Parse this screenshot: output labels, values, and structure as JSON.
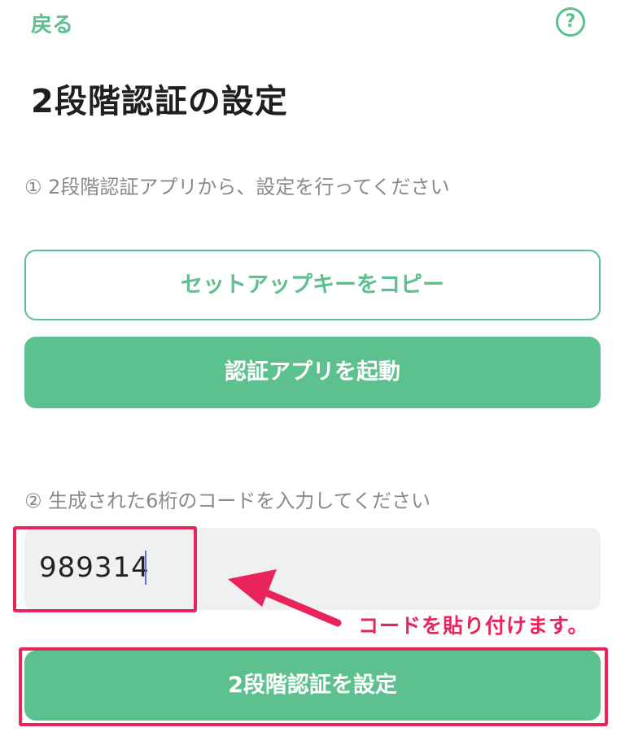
{
  "header": {
    "back_label": "戻る",
    "help_label": "?"
  },
  "page": {
    "title": "2段階認証の設定"
  },
  "steps": {
    "step1": "① 2段階認証アプリから、設定を行ってください",
    "step2": "② 生成された6桁のコードを入力してください"
  },
  "buttons": {
    "copy_setup_key": "セットアップキーをコピー",
    "launch_auth_app": "認証アプリを起動",
    "submit": "2段階認証を設定"
  },
  "code_input": {
    "value": "989314"
  },
  "annotation": {
    "text": "コードを貼り付けます。",
    "color": "#e8245a"
  },
  "colors": {
    "accent": "#5dc08f",
    "input_bg": "#eff0f1",
    "highlight": "#e8245a"
  },
  "icons": {
    "help": "question-circle-icon",
    "annotation": "arrow-icon"
  }
}
